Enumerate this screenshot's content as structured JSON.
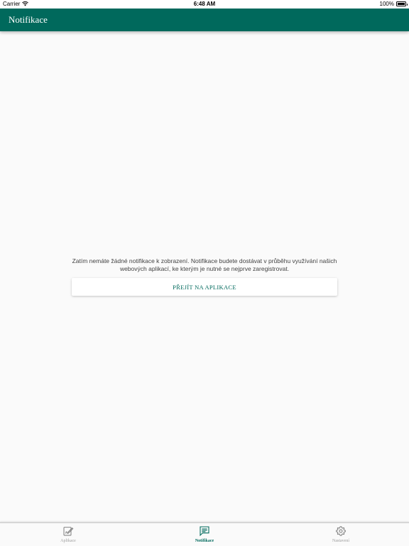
{
  "status_bar": {
    "carrier": "Carrier",
    "time": "6:48 AM",
    "battery": "100%"
  },
  "header": {
    "title": "Notifikace",
    "color": "#00695c"
  },
  "main": {
    "empty_message": "Zatím nemáte žádné notifikace k zobrazení. Notifikace budete dostávat v průběhu využívání našich webových aplikací, ke kterým je nutné se nejprve zaregistrovat.",
    "go_button_label": "PŘEJÍT NA APLIKACE"
  },
  "bottom_nav": {
    "items": [
      {
        "label": "Aplikace",
        "icon": "edit-note-icon",
        "active": false
      },
      {
        "label": "Notifikace",
        "icon": "chat-lines-icon",
        "active": true
      },
      {
        "label": "Nastavení",
        "icon": "gear-icon",
        "active": false
      }
    ],
    "active_color": "#00695c",
    "inactive_color": "#9e9e9e"
  }
}
